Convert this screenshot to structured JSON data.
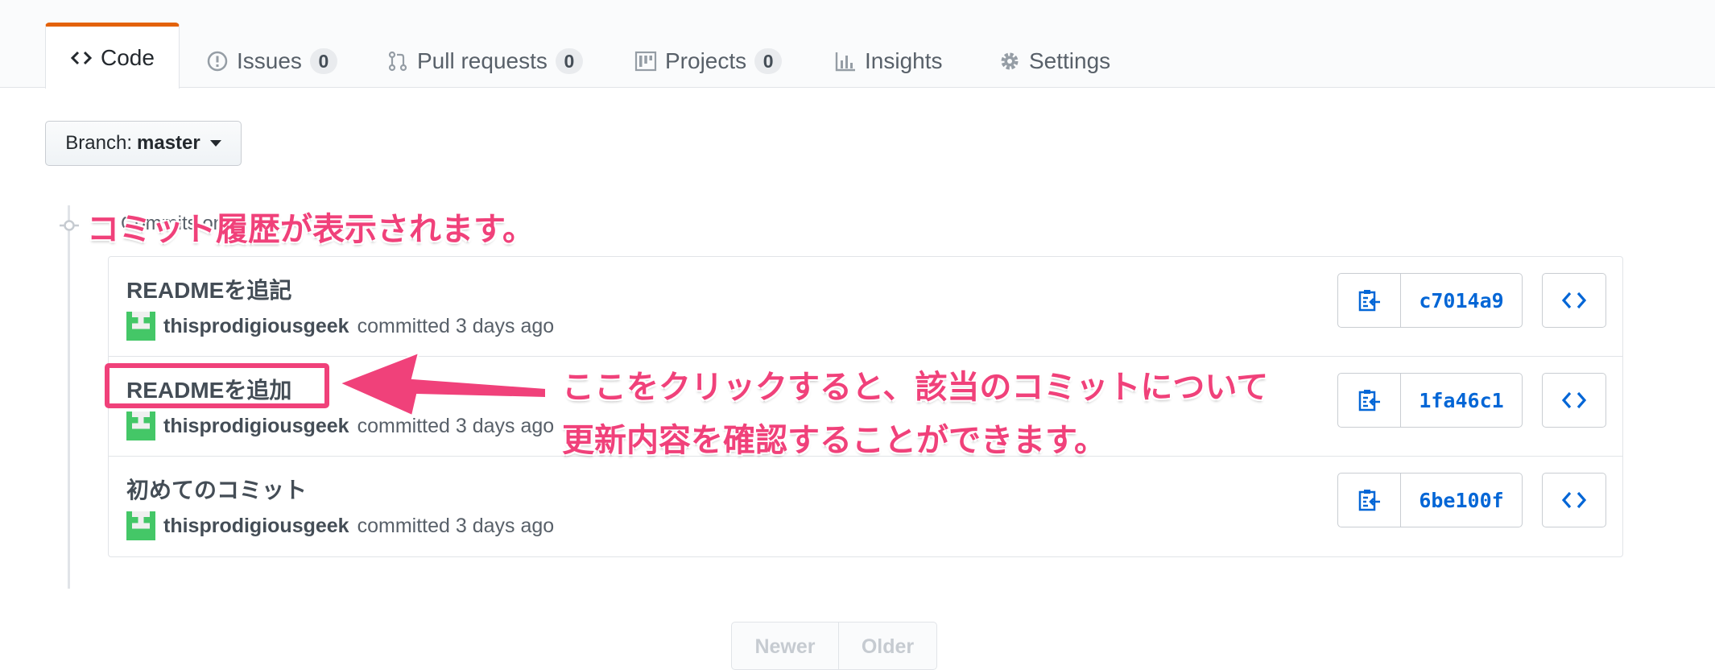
{
  "tabs": [
    {
      "label": "Code",
      "icon": "code-icon",
      "selected": true
    },
    {
      "label": "Issues",
      "icon": "issue-opened-icon",
      "count": "0"
    },
    {
      "label": "Pull requests",
      "icon": "git-pull-request-icon",
      "count": "0"
    },
    {
      "label": "Projects",
      "icon": "project-icon",
      "count": "0"
    },
    {
      "label": "Insights",
      "icon": "graph-icon"
    },
    {
      "label": "Settings",
      "icon": "gear-icon"
    }
  ],
  "branch": {
    "prefix": "Branch:",
    "name": "master"
  },
  "group_title": "Commits on ...",
  "commits": [
    {
      "title": "READMEを追記",
      "author": "thisprodigiousgeek",
      "meta": "committed 3 days ago",
      "sha": "c7014a9"
    },
    {
      "title": "READMEを追加",
      "author": "thisprodigiousgeek",
      "meta": "committed 3 days ago",
      "sha": "1fa46c1"
    },
    {
      "title": "初めてのコミット",
      "author": "thisprodigiousgeek",
      "meta": "committed 3 days ago",
      "sha": "6be100f"
    }
  ],
  "pagination": {
    "newer": "Newer",
    "older": "Older"
  },
  "annotations": {
    "history": "コミット履歴が表示されます。",
    "click_line1": "ここをクリックすると、該当のコミットについて",
    "click_line2": "更新内容を確認することができます。"
  },
  "colors": {
    "accent_tab": "#e36209",
    "link": "#0366d6",
    "annotation": "#f0417a",
    "avatar": "#44c767"
  }
}
